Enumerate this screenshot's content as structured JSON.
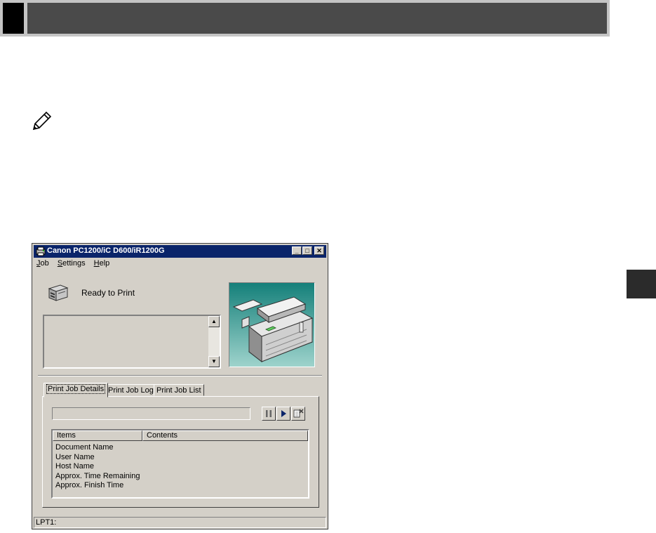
{
  "window": {
    "title": "Canon PC1200/iC D600/iR1200G",
    "controls": {
      "minimize": "_",
      "maximize": "□",
      "close": "✕"
    }
  },
  "menu": {
    "job": {
      "accel": "J",
      "rest": "ob"
    },
    "settings": {
      "accel": "S",
      "rest": "ettings"
    },
    "help": {
      "accel": "H",
      "rest": "elp"
    }
  },
  "status": {
    "text": "Ready to Print"
  },
  "tabs": [
    {
      "label": "Print Job Details",
      "active": true
    },
    {
      "label": "Print Job Log",
      "active": false
    },
    {
      "label": "Print Job List",
      "active": false
    }
  ],
  "job_details": {
    "columns": [
      "Items",
      "Contents"
    ],
    "rows": [
      "Document Name",
      "User Name",
      "Host Name",
      "Approx. Time Remaining",
      "Approx. Finish Time"
    ]
  },
  "statusbar": {
    "port": "LPT1:"
  },
  "icons": {
    "header": "note-pencil-icon",
    "title": "printer-app-icon",
    "printer": "printer-icon",
    "pause": "pause-icon",
    "resume": "play-icon",
    "delete": "delete-job-icon"
  },
  "colors": {
    "titlebar": "#0a246a",
    "window": "#d4d0c8",
    "printer_bg": "#15807a"
  }
}
